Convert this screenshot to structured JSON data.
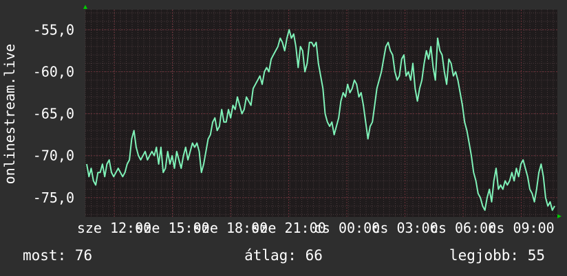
{
  "chart_data": {
    "type": "line",
    "ylabel": "onlinestream.live",
    "ylim": [
      -77.3,
      -52.6
    ],
    "y_ticks": [
      -55,
      -60,
      -65,
      -70,
      -75
    ],
    "y_tick_labels": [
      "-55,0",
      "-60,0",
      "-65,0",
      "-70,0",
      "-75,0"
    ],
    "x_tick_labels": [
      "sze 12:00",
      "sze 15:00",
      "sze 18:00",
      "sze 21:00",
      "cs 00:00",
      "cs 03:00",
      "cs 06:00",
      "cs 09:00"
    ],
    "grid": true,
    "colors": {
      "background": "#2e2e2e",
      "plot_background": "#1f1b1c",
      "minor_grid": "#4a3a3c",
      "major_grid": "#6a3038",
      "line": "#7ff2b8",
      "axis_arrow": "#00cc00",
      "text": "#ffffff"
    },
    "series": [
      {
        "values": [
          -71.0,
          -72.5,
          -71.5,
          -73.0,
          -73.5,
          -72.0,
          -72.0,
          -71.0,
          -72.5,
          -71.0,
          -70.5,
          -72.0,
          -72.5,
          -72.0,
          -71.5,
          -72.0,
          -72.5,
          -72.0,
          -71.0,
          -70.5,
          -68.0,
          -67.0,
          -69.0,
          -70.0,
          -70.5,
          -70.0,
          -69.5,
          -70.5,
          -70.0,
          -69.5,
          -70.0,
          -69.0,
          -71.0,
          -69.0,
          -72.0,
          -71.5,
          -69.5,
          -71.0,
          -70.0,
          -71.5,
          -69.5,
          -70.5,
          -71.5,
          -70.0,
          -69.0,
          -70.5,
          -69.5,
          -68.5,
          -69.0,
          -68.5,
          -69.5,
          -72.0,
          -71.0,
          -69.5,
          -68.0,
          -67.5,
          -66.0,
          -65.5,
          -67.0,
          -66.5,
          -64.5,
          -66.0,
          -66.0,
          -64.5,
          -65.5,
          -64.0,
          -64.5,
          -63.0,
          -64.0,
          -65.0,
          -64.5,
          -63.0,
          -63.5,
          -64.0,
          -62.0,
          -61.5,
          -61.0,
          -60.5,
          -61.5,
          -60.0,
          -59.5,
          -60.0,
          -58.5,
          -58.0,
          -57.5,
          -57.0,
          -56.0,
          -56.5,
          -57.5,
          -56.0,
          -55.0,
          -56.0,
          -55.5,
          -57.0,
          -59.5,
          -57.0,
          -57.5,
          -60.0,
          -59.0,
          -56.5,
          -56.5,
          -57.0,
          -56.5,
          -59.0,
          -60.5,
          -62.0,
          -65.0,
          -66.0,
          -66.5,
          -66.0,
          -67.5,
          -66.5,
          -65.5,
          -63.5,
          -62.5,
          -63.0,
          -61.5,
          -62.5,
          -62.0,
          -61.0,
          -61.5,
          -63.0,
          -62.5,
          -64.0,
          -66.0,
          -68.0,
          -66.5,
          -66.0,
          -64.0,
          -62.0,
          -61.0,
          -60.0,
          -58.5,
          -57.0,
          -56.5,
          -57.5,
          -58.0,
          -60.0,
          -61.0,
          -60.5,
          -58.5,
          -58.0,
          -60.5,
          -60.0,
          -61.0,
          -59.0,
          -62.0,
          -63.5,
          -62.0,
          -61.0,
          -59.0,
          -57.5,
          -58.5,
          -57.0,
          -59.5,
          -61.0,
          -56.0,
          -57.5,
          -58.0,
          -60.0,
          -61.5,
          -58.5,
          -59.0,
          -60.5,
          -60.0,
          -61.0,
          -62.5,
          -64.0,
          -66.0,
          -67.0,
          -68.5,
          -70.0,
          -72.0,
          -73.0,
          -74.5,
          -75.0,
          -76.0,
          -76.5,
          -75.0,
          -74.0,
          -75.5,
          -73.0,
          -71.5,
          -74.0,
          -73.5,
          -74.0,
          -73.0,
          -73.5,
          -73.0,
          -72.0,
          -73.0,
          -71.5,
          -72.5,
          -71.0,
          -70.5,
          -71.5,
          -72.5,
          -74.0,
          -74.5,
          -75.5,
          -74.0,
          -72.0,
          -71.0,
          -72.5,
          -75.0,
          -76.0,
          -75.5,
          -76.5,
          -76.0
        ]
      }
    ]
  },
  "stats": {
    "current": "most: 76",
    "average": "átlag: 66",
    "best": "legjobb: 55"
  }
}
